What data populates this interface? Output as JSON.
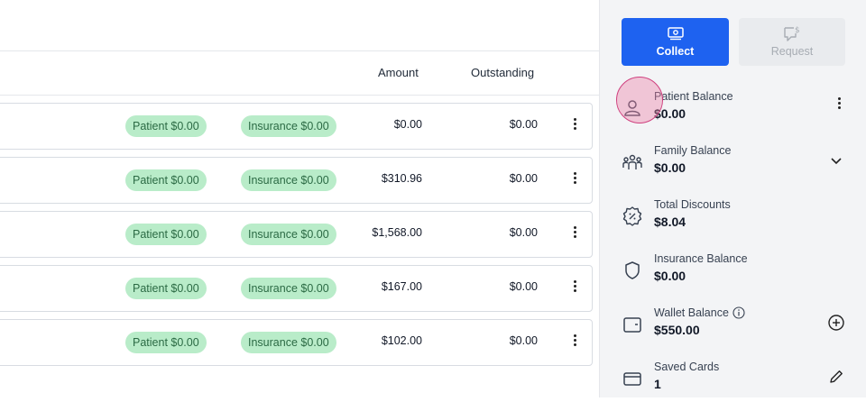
{
  "table": {
    "headers": {
      "amount": "Amount",
      "outstanding": "Outstanding"
    },
    "rows": [
      {
        "patient_badge": "Patient $0.00",
        "insurance_badge": "Insurance $0.00",
        "amount": "$0.00",
        "outstanding": "$0.00"
      },
      {
        "patient_badge": "Patient $0.00",
        "insurance_badge": "Insurance $0.00",
        "amount": "$310.96",
        "outstanding": "$0.00"
      },
      {
        "patient_badge": "Patient $0.00",
        "insurance_badge": "Insurance $0.00",
        "amount": "$1,568.00",
        "outstanding": "$0.00"
      },
      {
        "patient_badge": "Patient $0.00",
        "insurance_badge": "Insurance $0.00",
        "amount": "$167.00",
        "outstanding": "$0.00"
      },
      {
        "patient_badge": "Patient $0.00",
        "insurance_badge": "Insurance $0.00",
        "amount": "$102.00",
        "outstanding": "$0.00"
      }
    ]
  },
  "panel": {
    "collect_label": "Collect",
    "request_label": "Request",
    "items": [
      {
        "label": "Patient Balance",
        "value": "$0.00",
        "icon": "user-icon",
        "action": "more-vertical-icon"
      },
      {
        "label": "Family Balance",
        "value": "$0.00",
        "icon": "family-icon",
        "action": "chevron-down-icon"
      },
      {
        "label": "Total Discounts",
        "value": "$8.04",
        "icon": "discount-badge-icon"
      },
      {
        "label": "Insurance Balance",
        "value": "$0.00",
        "icon": "shield-icon"
      },
      {
        "label": "Wallet Balance",
        "value": "$550.00",
        "icon": "wallet-icon",
        "action": "plus-circle-icon"
      },
      {
        "label": "Saved Cards",
        "value": "1",
        "icon": "credit-card-icon",
        "action": "pencil-icon"
      }
    ]
  },
  "colors": {
    "primary": "#1e62f0",
    "badge_bg": "#b9ecc9",
    "badge_text": "#2b6a44",
    "highlight": "#cf3f7e"
  }
}
